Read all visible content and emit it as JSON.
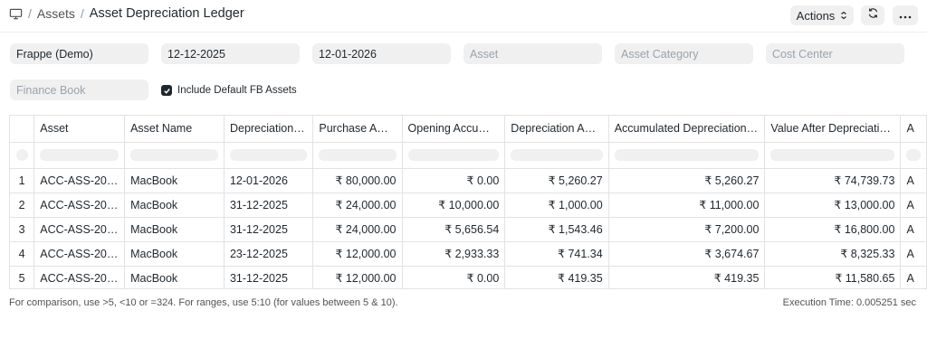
{
  "breadcrumb": {
    "parent": "Assets",
    "current": "Asset Depreciation Ledger",
    "separator": "/"
  },
  "toolbar": {
    "actions_label": "Actions"
  },
  "filters": {
    "company": "Frappe (Demo)",
    "from_date": "12-12-2025",
    "to_date": "12-01-2026",
    "asset_placeholder": "Asset",
    "asset_category_placeholder": "Asset Category",
    "cost_center_placeholder": "Cost Center",
    "finance_book_placeholder": "Finance Book",
    "include_default_fb_label": "Include Default FB Assets",
    "include_default_fb_checked": true
  },
  "table": {
    "columns": [
      "Asset",
      "Asset Name",
      "Depreciation…",
      "Purchase A…",
      "Opening Accu…",
      "Depreciation A…",
      "Accumulated Depreciation…",
      "Value After Depreciati…",
      "A"
    ],
    "rows": [
      [
        "1",
        "ACC-ASS-20…",
        "MacBook",
        "12-01-2026",
        "₹ 80,000.00",
        "₹ 0.00",
        "₹ 5,260.27",
        "₹ 5,260.27",
        "₹ 74,739.73",
        "A"
      ],
      [
        "2",
        "ACC-ASS-20…",
        "MacBook",
        "31-12-2025",
        "₹ 24,000.00",
        "₹ 10,000.00",
        "₹ 1,000.00",
        "₹ 11,000.00",
        "₹ 13,000.00",
        "A"
      ],
      [
        "3",
        "ACC-ASS-20…",
        "MacBook",
        "31-12-2025",
        "₹ 24,000.00",
        "₹ 5,656.54",
        "₹ 1,543.46",
        "₹ 7,200.00",
        "₹ 16,800.00",
        "A"
      ],
      [
        "4",
        "ACC-ASS-20…",
        "MacBook",
        "23-12-2025",
        "₹ 12,000.00",
        "₹ 2,933.33",
        "₹ 741.34",
        "₹ 3,674.67",
        "₹ 8,325.33",
        "A"
      ],
      [
        "5",
        "ACC-ASS-20…",
        "MacBook",
        "31-12-2025",
        "₹ 12,000.00",
        "₹ 0.00",
        "₹ 419.35",
        "₹ 419.35",
        "₹ 11,580.65",
        "A"
      ]
    ]
  },
  "footer": {
    "hint": "For comparison, use >5, <10 or =324. For ranges, use 5:10 (for values between 5 & 10).",
    "execution_time": "Execution Time: 0.005251 sec"
  }
}
